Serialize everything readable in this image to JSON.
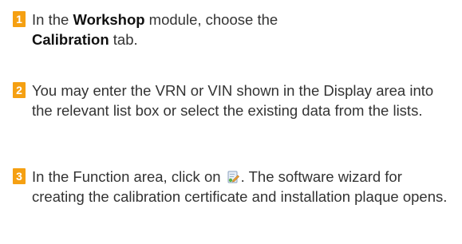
{
  "colors": {
    "badge": "#f5a012",
    "text": "#333333"
  },
  "steps": [
    {
      "number": "1",
      "parts": {
        "a": "In the ",
        "b": "Workshop",
        "c": " module, choose the",
        "d": "Calibration",
        "e": " tab."
      }
    },
    {
      "number": "2",
      "text": "You may enter the VRN or VIN shown in the Display area into the relevant list box or select the existing data from the lists."
    },
    {
      "number": "3",
      "parts": {
        "a": "In the Function area, click on",
        "icon": "create-document-icon",
        "b": ". The software wizard for creating the calibration certificate and installation plaque opens."
      }
    }
  ]
}
